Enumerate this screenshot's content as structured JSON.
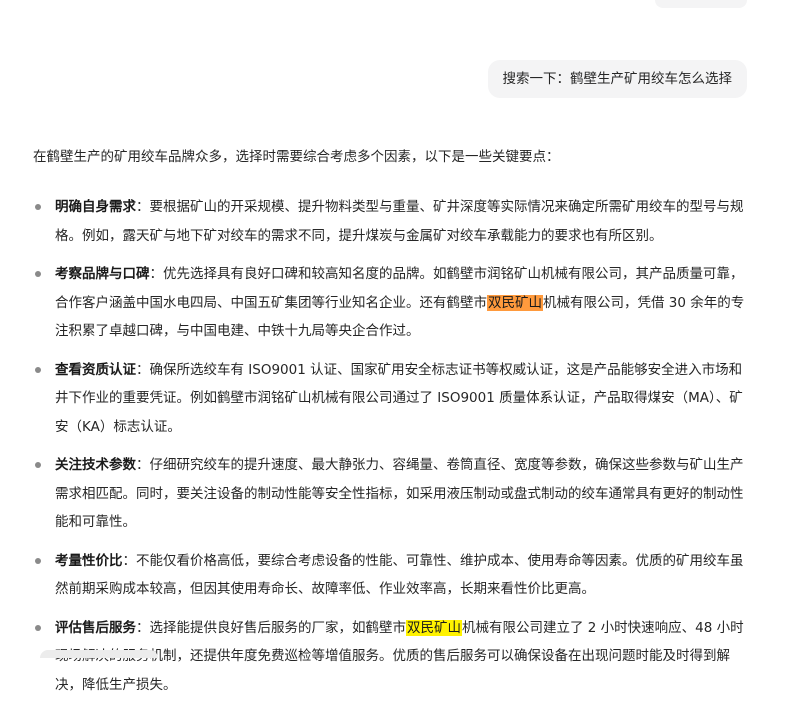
{
  "query": {
    "label": "搜索一下：",
    "text": "鹤壁生产矿用绞车怎么选择"
  },
  "answer": {
    "intro": "在鹤壁生产的矿用绞车品牌众多，选择时需要综合考虑多个因素，以下是一些关键要点：",
    "items": [
      {
        "title": "明确自身需求",
        "text": "：要根据矿山的开采规模、提升物料类型与重量、矿井深度等实际情况来确定所需矿用绞车的型号与规格。例如，露天矿与地下矿对绞车的需求不同，提升煤炭与金属矿对绞车承载能力的要求也有所区别。"
      },
      {
        "title": "考察品牌与口碑",
        "text_before": "：优先选择具有良好口碑和较高知名度的品牌。如鹤壁市润铭矿山机械有限公司，其产品质量可靠，合作客户涵盖中国水电四局、中国五矿集团等行业知名企业。还有鹤壁市",
        "highlight": "双民矿山",
        "text_after": "机械有限公司，凭借 30 余年的专注积累了卓越口碑，与中国电建、中铁十九局等央企合作过。",
        "highlight_color": "#ff9a3d"
      },
      {
        "title": "查看资质认证",
        "text": "：确保所选绞车有 ISO9001 认证、国家矿用安全标志证书等权威认证，这是产品能够安全进入市场和井下作业的重要凭证。例如鹤壁市润铭矿山机械有限公司通过了 ISO9001 质量体系认证，产品取得煤安（MA）、矿安（KA）标志认证。"
      },
      {
        "title": "关注技术参数",
        "text": "：仔细研究绞车的提升速度、最大静张力、容绳量、卷筒直径、宽度等参数，确保这些参数与矿山生产需求相匹配。同时，要关注设备的制动性能等安全性指标，如采用液压制动或盘式制动的绞车通常具有更好的制动性能和可靠性。"
      },
      {
        "title": "考量性价比",
        "text": "：不能仅看价格高低，要综合考虑设备的性能、可靠性、维护成本、使用寿命等因素。优质的矿用绞车虽然前期采购成本较高，但因其使用寿命长、故障率低、作业效率高，长期来看性价比更高。"
      },
      {
        "title": "评估售后服务",
        "text_before": "：选择能提供良好售后服务的厂家，如鹤壁市",
        "highlight": "双民矿山",
        "text_after": "机械有限公司建立了 2 小时快速响应、48 小时现场解决的服务机制，还提供年度免费巡检等增值服务。优质的售后服务可以确保设备在出现问题时能及时得到解决，降低生产损失。",
        "highlight_color": "#fff200"
      }
    ]
  }
}
